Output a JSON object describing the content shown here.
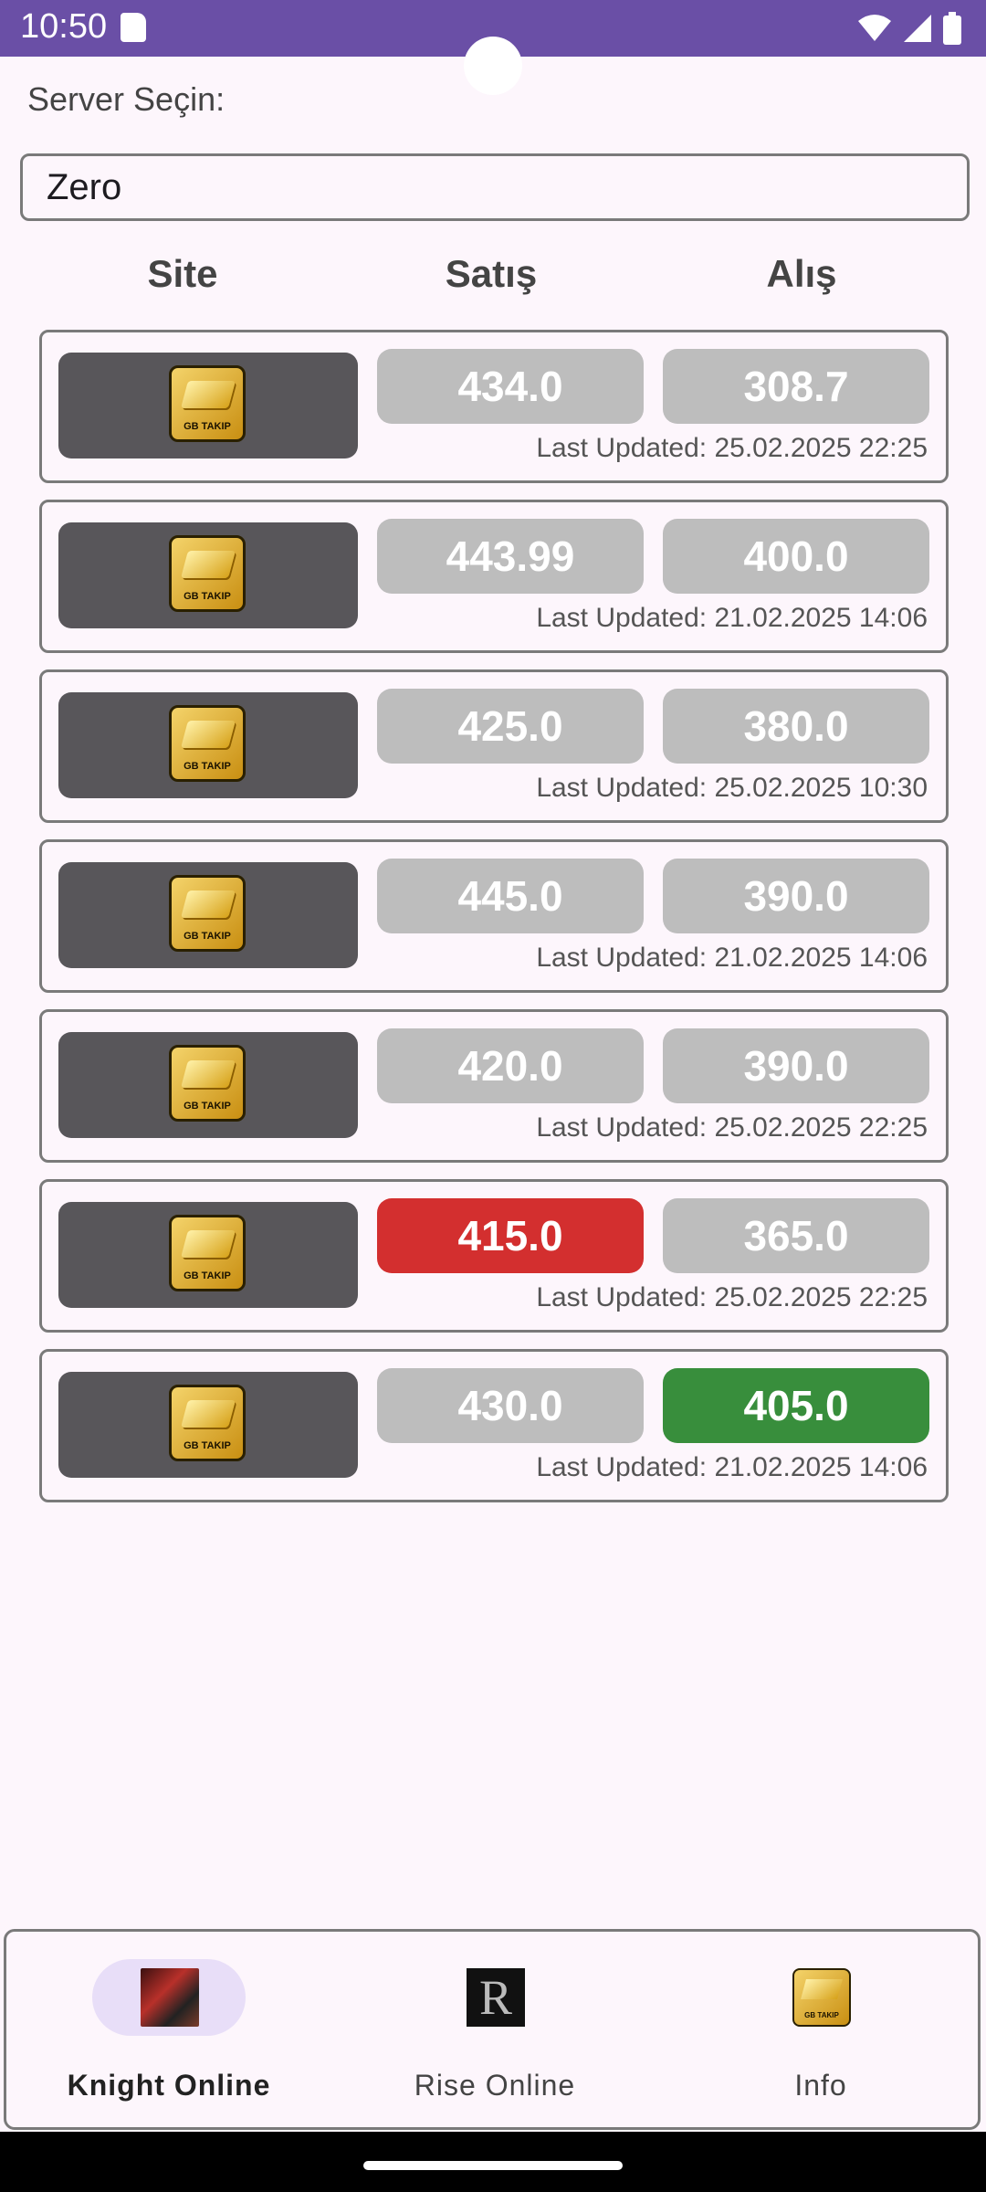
{
  "status_bar": {
    "time": "10:50"
  },
  "server": {
    "label": "Server Seçin:",
    "selected": "Zero"
  },
  "columns": {
    "site": "Site",
    "sell": "Satış",
    "buy": "Alış"
  },
  "logo_text": "GB TAKIP",
  "colors": {
    "accent": "#6a4fa6",
    "neutral_price": "#bdbdbd",
    "best_sell": "#d32f2f",
    "best_buy": "#388e3c",
    "active_nav": "#e8def8"
  },
  "rows": [
    {
      "sell": "434.0",
      "buy": "308.7",
      "updated": "Last Updated: 25.02.2025 22:25",
      "sell_state": "neutral",
      "buy_state": "neutral"
    },
    {
      "sell": "443.99",
      "buy": "400.0",
      "updated": "Last Updated: 21.02.2025 14:06",
      "sell_state": "neutral",
      "buy_state": "neutral"
    },
    {
      "sell": "425.0",
      "buy": "380.0",
      "updated": "Last Updated: 25.02.2025 10:30",
      "sell_state": "neutral",
      "buy_state": "neutral"
    },
    {
      "sell": "445.0",
      "buy": "390.0",
      "updated": "Last Updated: 21.02.2025 14:06",
      "sell_state": "neutral",
      "buy_state": "neutral"
    },
    {
      "sell": "420.0",
      "buy": "390.0",
      "updated": "Last Updated: 25.02.2025 22:25",
      "sell_state": "neutral",
      "buy_state": "neutral"
    },
    {
      "sell": "415.0",
      "buy": "365.0",
      "updated": "Last Updated: 25.02.2025 22:25",
      "sell_state": "red",
      "buy_state": "neutral"
    },
    {
      "sell": "430.0",
      "buy": "405.0",
      "updated": "Last Updated: 21.02.2025 14:06",
      "sell_state": "neutral",
      "buy_state": "green"
    }
  ],
  "bottom_nav": [
    {
      "label": "Knight Online",
      "icon": "knight-online-icon",
      "active": true
    },
    {
      "label": "Rise Online",
      "icon": "rise-online-icon",
      "active": false
    },
    {
      "label": "Info",
      "icon": "info-gb-takip-icon",
      "active": false
    }
  ],
  "rise_glyph": "R"
}
